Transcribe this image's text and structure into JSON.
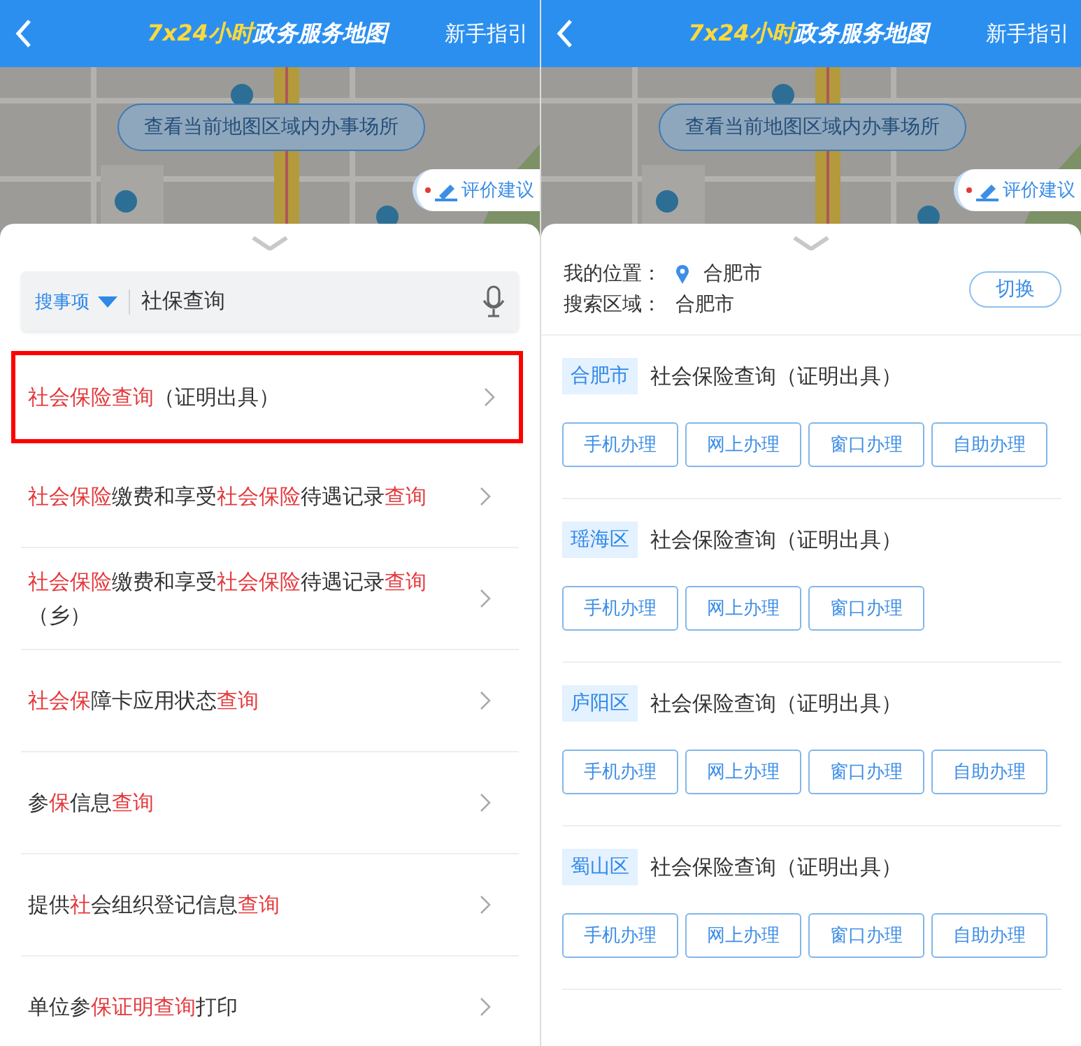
{
  "left": {
    "header": {
      "title": "**7x24小时**政务服务地图",
      "guide": "新手指引"
    },
    "map": {
      "kind": "picture",
      "view_button": "查看当前地图区域内办事场所",
      "feedback_button": "评价建议"
    },
    "search": {
      "scope": "搜事项",
      "value": "社保查询"
    },
    "results": [
      {
        "text": "**社会保险查询**（证明出具）",
        "selected": true
      },
      {
        "text": "**社会保险**缴费和享受**社会保险**待遇记录**查询**",
        "selected": false
      },
      {
        "text": "**社会保险**缴费和享受**社会保险**待遇记录**查询**（乡）",
        "selected": false
      },
      {
        "text": "**社会保**障卡应用状态**查询**",
        "selected": false
      },
      {
        "text": "参**保**信息**查询**",
        "selected": false
      },
      {
        "text": "提供**社**会组织登记信息**查询**",
        "selected": false
      },
      {
        "text": "单位参**保证明查询**打印",
        "selected": false
      }
    ]
  },
  "right": {
    "header": {
      "title": "**7x24小时**政务服务地图",
      "guide": "新手指引"
    },
    "map": {
      "kind": "picture",
      "view_button": "查看当前地图区域内办事场所",
      "feedback_button": "评价建议"
    },
    "location": {
      "my_label": "我的位置：",
      "my_value": "合肥市",
      "area_label": "搜索区域：",
      "area_value": "合肥市",
      "switch_button": "切换"
    },
    "offices": [
      {
        "region": "合肥市",
        "title": "社会保险查询（证明出具）",
        "buttons": [
          "手机办理",
          "网上办理",
          "窗口办理",
          "自助办理"
        ]
      },
      {
        "region": "瑶海区",
        "title": "社会保险查询（证明出具）",
        "buttons": [
          "手机办理",
          "网上办理",
          "窗口办理"
        ]
      },
      {
        "region": "庐阳区",
        "title": "社会保险查询（证明出具）",
        "buttons": [
          "手机办理",
          "网上办理",
          "窗口办理",
          "自助办理"
        ]
      },
      {
        "region": "蜀山区",
        "title": "社会保险查询（证明出具）",
        "buttons": [
          "手机办理",
          "网上办理",
          "窗口办理",
          "自助办理"
        ]
      }
    ]
  }
}
